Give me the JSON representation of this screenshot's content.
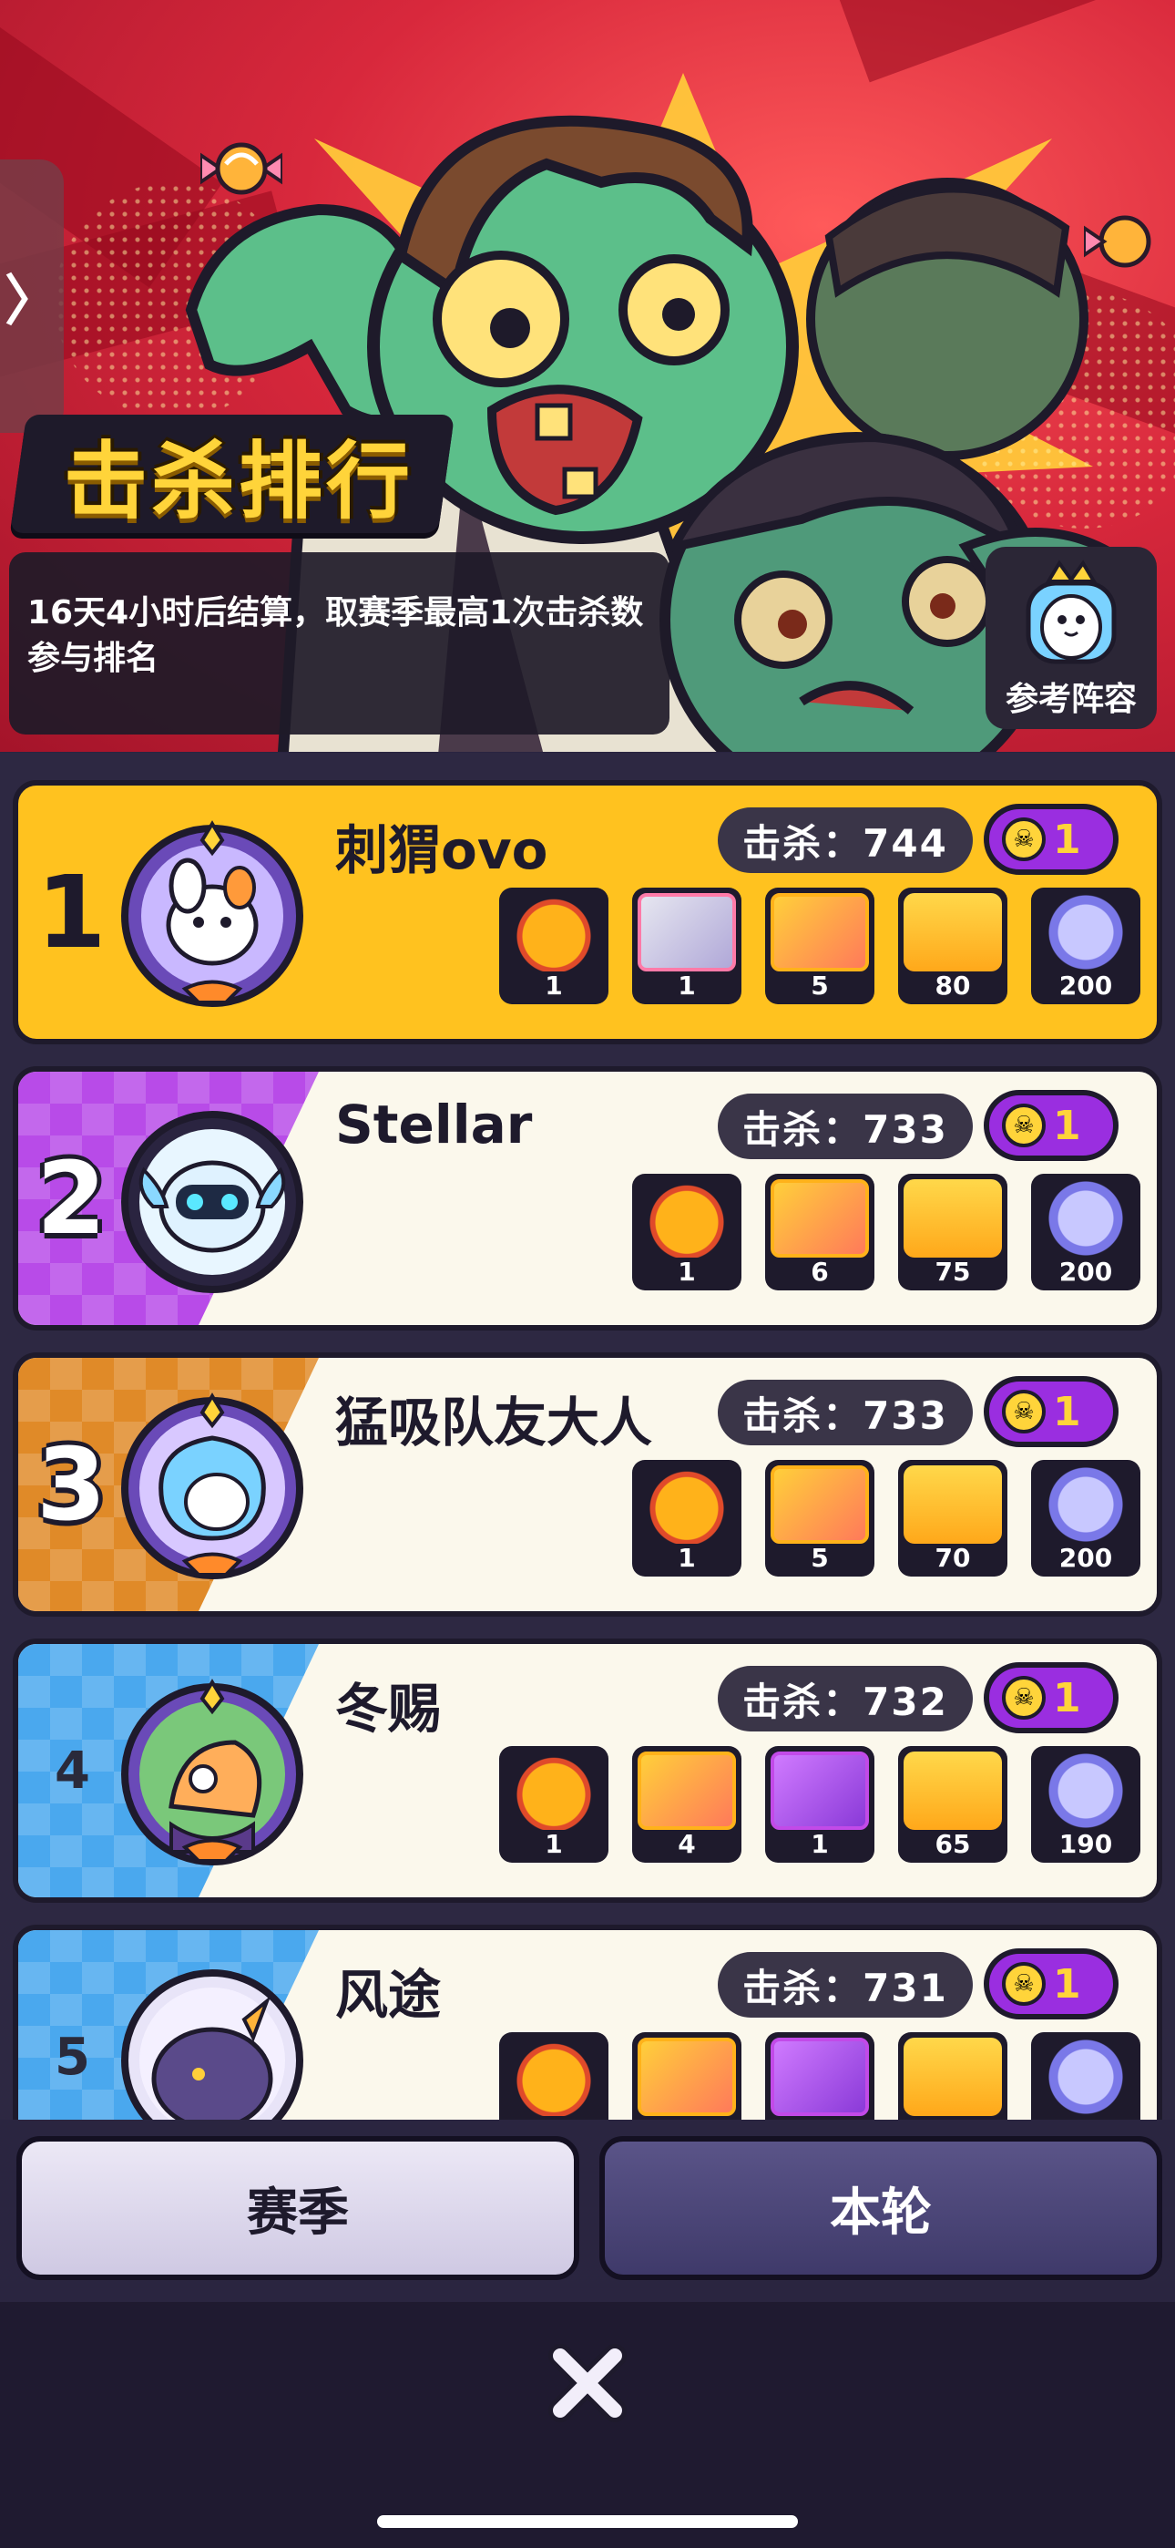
{
  "banner": {
    "title": "击杀排行",
    "info": "16天4小时后结算，取赛季最高1次击杀数参与排名",
    "side_tab_icon": "chevron-right-icon",
    "reference_label": "参考阵容"
  },
  "ranking": [
    {
      "rank": "1",
      "name": "刺猬ovo",
      "kills": "击杀：744",
      "badge": "1",
      "accent": "#ffc21f",
      "rewards": [
        {
          "icon": "frame-reward-icon",
          "count": "1"
        },
        {
          "icon": "card-pack-icon",
          "count": "1"
        },
        {
          "icon": "card-pack-gold-icon",
          "count": "5"
        },
        {
          "icon": "ticket-icon",
          "count": "80"
        },
        {
          "icon": "capsule-icon",
          "count": "200"
        }
      ]
    },
    {
      "rank": "2",
      "name": "Stellar",
      "kills": "击杀：733",
      "badge": "1",
      "accent": "#b84be8",
      "rewards": [
        {
          "icon": "frame-reward-icon",
          "count": "1"
        },
        {
          "icon": "card-pack-gold-icon",
          "count": "6"
        },
        {
          "icon": "ticket-icon",
          "count": "75"
        },
        {
          "icon": "capsule-icon",
          "count": "200"
        }
      ]
    },
    {
      "rank": "3",
      "name": "猛吸队友大人",
      "kills": "击杀：733",
      "badge": "1",
      "accent": "#e08a28",
      "rewards": [
        {
          "icon": "frame-reward-icon",
          "count": "1"
        },
        {
          "icon": "card-pack-gold-icon",
          "count": "5"
        },
        {
          "icon": "ticket-icon",
          "count": "70"
        },
        {
          "icon": "capsule-icon",
          "count": "200"
        }
      ]
    },
    {
      "rank": "4",
      "name": "冬赐",
      "kills": "击杀：732",
      "badge": "1",
      "accent": "#4aa8ee",
      "rewards": [
        {
          "icon": "frame-reward-icon",
          "count": "1"
        },
        {
          "icon": "card-pack-gold-icon",
          "count": "4"
        },
        {
          "icon": "card-pack-purple-icon",
          "count": "1"
        },
        {
          "icon": "ticket-icon",
          "count": "65"
        },
        {
          "icon": "capsule-icon",
          "count": "190"
        }
      ]
    },
    {
      "rank": "5",
      "name": "风途",
      "kills": "击杀：731",
      "badge": "1",
      "accent": "#4aa8ee",
      "rewards": [
        {
          "icon": "frame-reward-icon",
          "count": ""
        },
        {
          "icon": "card-pack-gold-icon",
          "count": ""
        },
        {
          "icon": "card-pack-purple-icon",
          "count": ""
        },
        {
          "icon": "ticket-icon",
          "count": ""
        },
        {
          "icon": "capsule-icon",
          "count": ""
        }
      ]
    }
  ],
  "tabs": {
    "season": "赛季",
    "round": "本轮"
  },
  "close_icon": "close-icon"
}
